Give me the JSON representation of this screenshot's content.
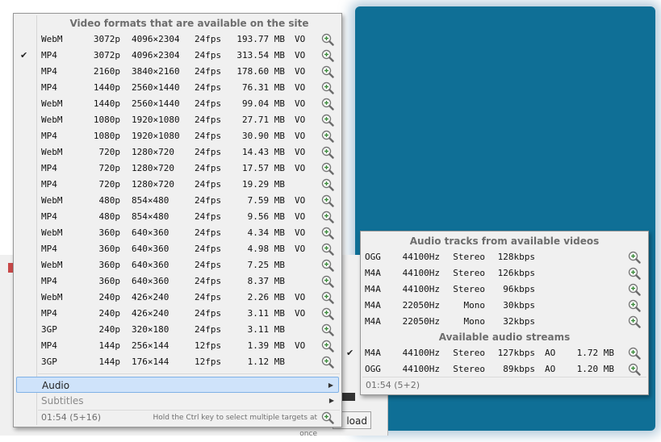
{
  "video_menu": {
    "header": "Video formats that are available on the site",
    "rows": [
      {
        "checked": false,
        "cols": [
          "WebM",
          "3072p",
          "4096×2304",
          "24fps",
          "193.77 MB",
          "VO"
        ]
      },
      {
        "checked": true,
        "cols": [
          "MP4",
          "3072p",
          "4096×2304",
          "24fps",
          "313.54 MB",
          "VO"
        ]
      },
      {
        "checked": false,
        "cols": [
          "MP4",
          "2160p",
          "3840×2160",
          "24fps",
          "178.60 MB",
          "VO"
        ]
      },
      {
        "checked": false,
        "cols": [
          "MP4",
          "1440p",
          "2560×1440",
          "24fps",
          "76.31 MB",
          "VO"
        ]
      },
      {
        "checked": false,
        "cols": [
          "WebM",
          "1440p",
          "2560×1440",
          "24fps",
          "99.04 MB",
          "VO"
        ]
      },
      {
        "checked": false,
        "cols": [
          "WebM",
          "1080p",
          "1920×1080",
          "24fps",
          "27.71 MB",
          "VO"
        ]
      },
      {
        "checked": false,
        "cols": [
          "MP4",
          "1080p",
          "1920×1080",
          "24fps",
          "30.90 MB",
          "VO"
        ]
      },
      {
        "checked": false,
        "cols": [
          "WebM",
          "720p",
          "1280×720",
          "24fps",
          "14.43 MB",
          "VO"
        ]
      },
      {
        "checked": false,
        "cols": [
          "MP4",
          "720p",
          "1280×720",
          "24fps",
          "17.57 MB",
          "VO"
        ]
      },
      {
        "checked": false,
        "cols": [
          "MP4",
          "720p",
          "1280×720",
          "24fps",
          "19.29 MB",
          ""
        ]
      },
      {
        "checked": false,
        "cols": [
          "WebM",
          "480p",
          "854×480",
          "24fps",
          "7.59 MB",
          "VO"
        ]
      },
      {
        "checked": false,
        "cols": [
          "MP4",
          "480p",
          "854×480",
          "24fps",
          "9.56 MB",
          "VO"
        ]
      },
      {
        "checked": false,
        "cols": [
          "WebM",
          "360p",
          "640×360",
          "24fps",
          "4.34 MB",
          "VO"
        ]
      },
      {
        "checked": false,
        "cols": [
          "MP4",
          "360p",
          "640×360",
          "24fps",
          "4.98 MB",
          "VO"
        ]
      },
      {
        "checked": false,
        "cols": [
          "WebM",
          "360p",
          "640×360",
          "24fps",
          "7.25 MB",
          ""
        ]
      },
      {
        "checked": false,
        "cols": [
          "MP4",
          "360p",
          "640×360",
          "24fps",
          "8.37 MB",
          ""
        ]
      },
      {
        "checked": false,
        "cols": [
          "WebM",
          "240p",
          "426×240",
          "24fps",
          "2.26 MB",
          "VO"
        ]
      },
      {
        "checked": false,
        "cols": [
          "MP4",
          "240p",
          "426×240",
          "24fps",
          "3.11 MB",
          "VO"
        ]
      },
      {
        "checked": false,
        "cols": [
          "3GP",
          "240p",
          "320×180",
          "24fps",
          "3.11 MB",
          ""
        ]
      },
      {
        "checked": false,
        "cols": [
          "MP4",
          "144p",
          "256×144",
          "12fps",
          "1.39 MB",
          "VO"
        ]
      },
      {
        "checked": false,
        "cols": [
          "3GP",
          "144p",
          "176×144",
          "12fps",
          "1.12 MB",
          ""
        ]
      }
    ],
    "submenus": [
      {
        "label": "Audio",
        "selected": true,
        "disabled": false
      },
      {
        "label": "Subtitles",
        "selected": false,
        "disabled": true
      }
    ],
    "footer_left": "01:54 (5+16)",
    "footer_right": "Hold the Ctrl key to select multiple targets at once"
  },
  "audio_menu": {
    "header": "Audio tracks from available videos",
    "tracks": [
      {
        "checked": false,
        "cols": [
          "OGG",
          "44100Hz",
          "Stereo",
          "128kbps"
        ]
      },
      {
        "checked": false,
        "cols": [
          "M4A",
          "44100Hz",
          "Stereo",
          "126kbps"
        ]
      },
      {
        "checked": false,
        "cols": [
          "M4A",
          "44100Hz",
          "Stereo",
          "96kbps"
        ]
      },
      {
        "checked": false,
        "cols": [
          "M4A",
          "22050Hz",
          "Mono",
          "30kbps"
        ]
      },
      {
        "checked": false,
        "cols": [
          "M4A",
          "22050Hz",
          "Mono",
          "32kbps"
        ]
      }
    ],
    "streams_header": "Available audio streams",
    "streams": [
      {
        "checked": true,
        "cols": [
          "M4A",
          "44100Hz",
          "Stereo",
          "127kbps",
          "AO",
          "1.72 MB"
        ]
      },
      {
        "checked": false,
        "cols": [
          "OGG",
          "44100Hz",
          "Stereo",
          "89kbps",
          "AO",
          "1.20 MB"
        ]
      }
    ],
    "footer": "01:54 (5+2)"
  },
  "background": {
    "button_label": "load"
  },
  "icons": {
    "check": "✔",
    "arrow": "▶",
    "zoom": "magnifier-plus-icon"
  }
}
